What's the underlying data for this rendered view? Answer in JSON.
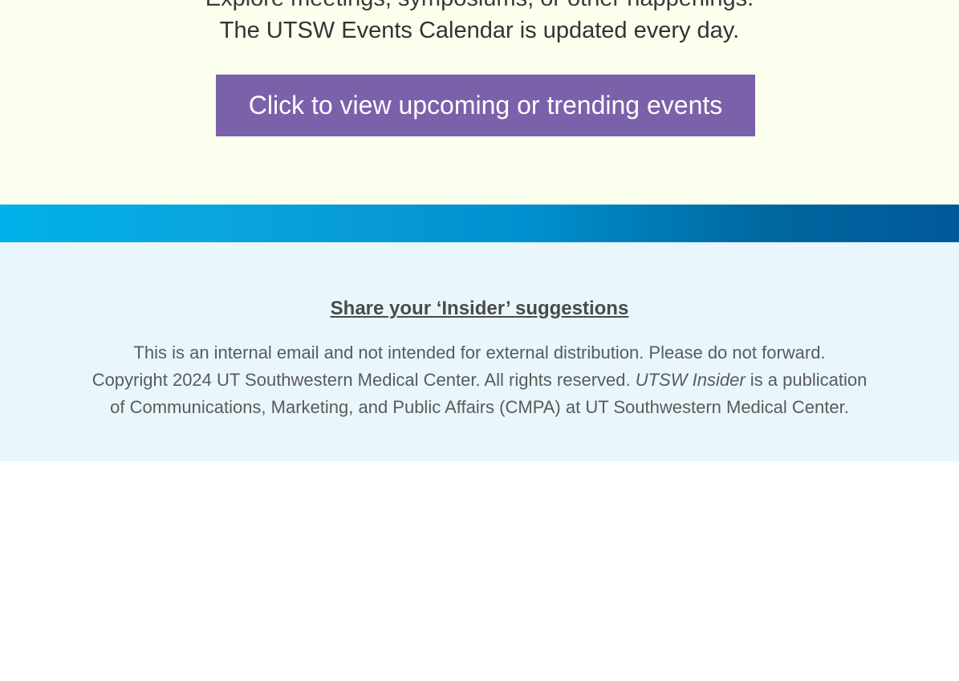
{
  "events": {
    "partial_line": "Explore meetings, symposiums, or other happenings.",
    "calendar_line": "The UTSW Events Calendar is updated every day.",
    "button_label": "Click to view upcoming or trending events"
  },
  "footer": {
    "suggestions_link": "Share your ‘Insider’ suggestions",
    "line1": "This is an internal email and not intended for external distribution. Please do not forward.",
    "line2_before": "Copyright 2024 UT Southwestern Medical Center. All rights reserved. ",
    "publication_name": "UTSW Insider",
    "line2_after": " is a publication",
    "line3": "of Communications, Marketing, and Public Affairs (CMPA) at UT Southwestern Medical Center."
  },
  "colors": {
    "events_bg": "#fbffee",
    "button_bg": "#7b60aa",
    "band_start": "#00b1ea",
    "band_end": "#00589a",
    "footer_bg": "#e9f7fd"
  }
}
